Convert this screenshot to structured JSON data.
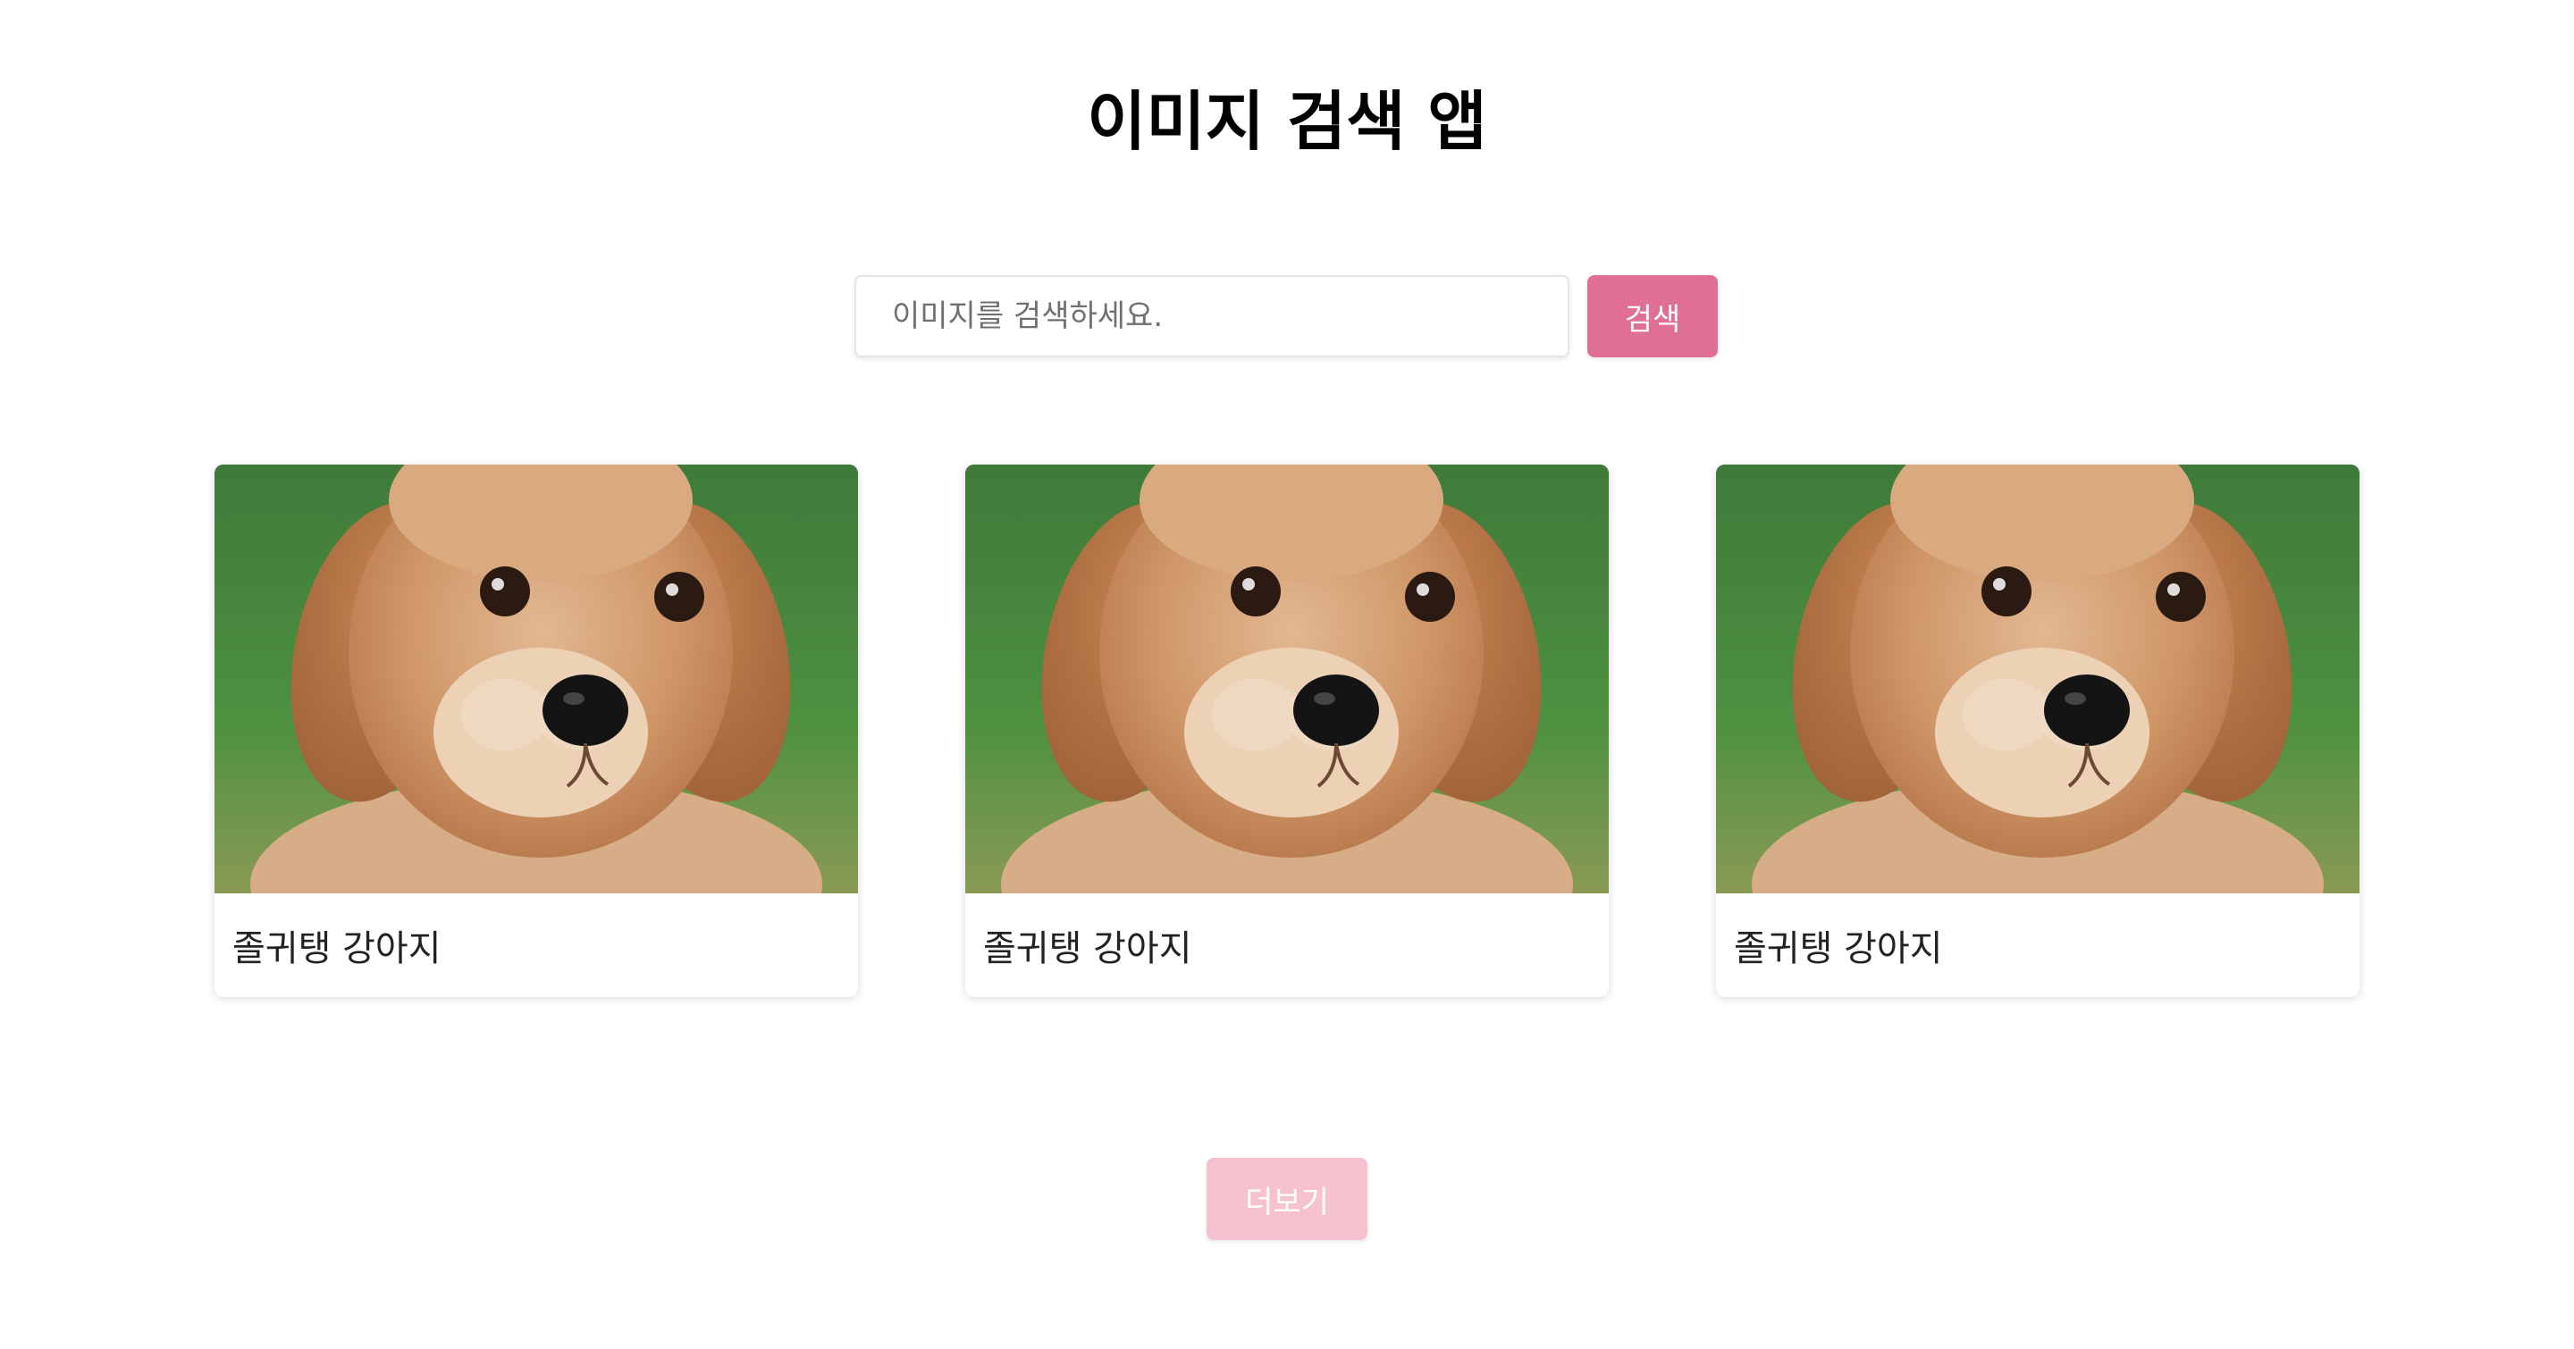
{
  "app": {
    "title": "이미지 검색 앱"
  },
  "search": {
    "placeholder": "이미지를 검색하세요.",
    "value": "",
    "button_label": "검색"
  },
  "results": [
    {
      "caption": "졸귀탱 강아지",
      "image": "puppy-photo"
    },
    {
      "caption": "졸귀탱 강아지",
      "image": "puppy-photo"
    },
    {
      "caption": "졸귀탱 강아지",
      "image": "puppy-photo"
    }
  ],
  "load_more": {
    "label": "더보기",
    "state": "disabled"
  },
  "colors": {
    "accent": "#e07093",
    "accent_disabled": "#f7c2cf"
  }
}
